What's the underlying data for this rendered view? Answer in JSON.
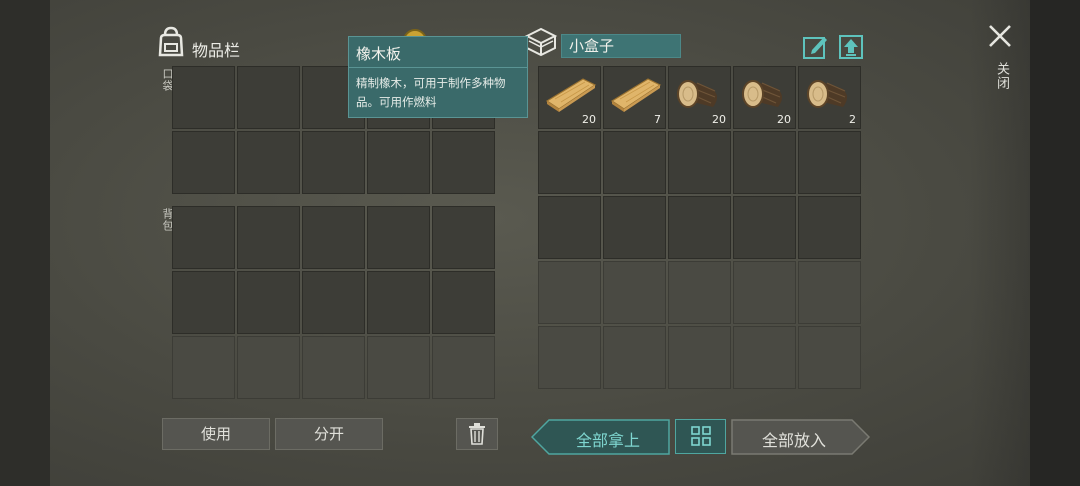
{
  "inventory": {
    "title": "物品栏",
    "pocket_label": "口袋",
    "backpack_label": "背包"
  },
  "tooltip": {
    "title": "橡木板",
    "description": "精制橡木，可用于制作多种物品。可用作燃料"
  },
  "container": {
    "name": "小盒子",
    "items": [
      {
        "icon": "oak-plank-icon",
        "qty": "20"
      },
      {
        "icon": "oak-plank-icon",
        "qty": "7"
      },
      {
        "icon": "oak-log-icon",
        "qty": "20"
      },
      {
        "icon": "oak-log-icon",
        "qty": "20"
      },
      {
        "icon": "oak-log-icon",
        "qty": "2"
      }
    ]
  },
  "buttons": {
    "use": "使用",
    "split": "分开",
    "take_all": "全部拿上",
    "put_all": "全部放入"
  },
  "close_label": "关闭",
  "colors": {
    "accent_teal": "#3e7474",
    "take_all_text": "#7fd6d0",
    "bg": "#4a4a42"
  }
}
